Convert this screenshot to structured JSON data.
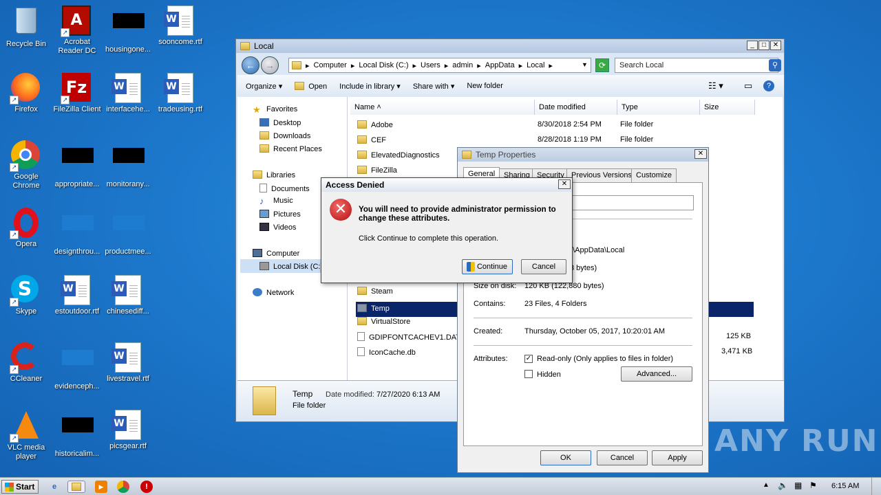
{
  "desktop": {
    "icons": [
      {
        "label": "Recycle Bin"
      },
      {
        "label": "Acrobat Reader DC"
      },
      {
        "label": "housingone..."
      },
      {
        "label": "sooncome.rtf"
      },
      {
        "label": "Firefox"
      },
      {
        "label": "FileZilla Client"
      },
      {
        "label": "interfacehe..."
      },
      {
        "label": "tradeusing.rtf"
      },
      {
        "label": "Google Chrome"
      },
      {
        "label": "appropriate..."
      },
      {
        "label": "monitorany..."
      },
      {
        "label": "Opera"
      },
      {
        "label": "designthrou..."
      },
      {
        "label": "productmee..."
      },
      {
        "label": "Skype"
      },
      {
        "label": "estoutdoor.rtf"
      },
      {
        "label": "chinesediff..."
      },
      {
        "label": "CCleaner"
      },
      {
        "label": "evidenceph..."
      },
      {
        "label": "livestravel.rtf"
      },
      {
        "label": "VLC media player"
      },
      {
        "label": "historicalim..."
      },
      {
        "label": "picsgear.rtf"
      }
    ]
  },
  "explorer": {
    "title": "Local",
    "breadcrumb": [
      "Computer",
      "Local Disk (C:)",
      "Users",
      "admin",
      "AppData",
      "Local"
    ],
    "search_placeholder": "Search Local",
    "toolbar": {
      "organize": "Organize",
      "open": "Open",
      "include": "Include in library",
      "share": "Share with",
      "new_folder": "New folder"
    },
    "nav": {
      "favorites": "Favorites",
      "desktop": "Desktop",
      "downloads": "Downloads",
      "recent": "Recent Places",
      "libraries": "Libraries",
      "documents": "Documents",
      "music": "Music",
      "pictures": "Pictures",
      "videos": "Videos",
      "computer": "Computer",
      "local_disk": "Local Disk (C:)",
      "network": "Network"
    },
    "columns": {
      "name": "Name",
      "date": "Date modified",
      "type": "Type",
      "size": "Size"
    },
    "files": [
      {
        "name": "Adobe",
        "date": "8/30/2018 2:54 PM",
        "type": "File folder",
        "size": ""
      },
      {
        "name": "CEF",
        "date": "8/28/2018 1:19 PM",
        "type": "File folder",
        "size": ""
      },
      {
        "name": "ElevatedDiagnostics",
        "date": "",
        "type": "",
        "size": ""
      },
      {
        "name": "FileZilla",
        "date": "",
        "type": "",
        "size": ""
      },
      {
        "name": "Steam",
        "date": "",
        "type": "",
        "size": ""
      },
      {
        "name": "Temp",
        "date": "",
        "type": "",
        "size": ""
      },
      {
        "name": "VirtualStore",
        "date": "",
        "type": "",
        "size": ""
      },
      {
        "name": "GDIPFONTCACHEV1.DAT",
        "date": "",
        "type": "",
        "size": "125 KB"
      },
      {
        "name": "IconCache.db",
        "date": "",
        "type": "",
        "size": "3,471 KB"
      }
    ],
    "details": {
      "name": "Temp",
      "date_label": "Date modified:",
      "date_value": "7/27/2020 6:13 AM",
      "type": "File folder"
    }
  },
  "properties": {
    "title": "Temp Properties",
    "tabs": [
      "General",
      "Sharing",
      "Security",
      "Previous Versions",
      "Customize"
    ],
    "location_partial": "n\\AppData\\Local",
    "size_partial": "3 bytes)",
    "size_on_disk_label": "Size on disk:",
    "size_on_disk_value": "120 KB (122,880 bytes)",
    "contains_label": "Contains:",
    "contains_value": "23 Files, 4 Folders",
    "created_label": "Created:",
    "created_value": "Thursday, October 05, 2017, 10:20:01 AM",
    "attributes_label": "Attributes:",
    "readonly": "Read-only (Only applies to files in folder)",
    "hidden": "Hidden",
    "advanced": "Advanced...",
    "ok": "OK",
    "cancel": "Cancel",
    "apply": "Apply"
  },
  "dialog": {
    "title": "Access Denied",
    "message": "You will need to provide administrator permission to change these attributes.",
    "hint": "Click Continue to complete this operation.",
    "continue": "Continue",
    "cancel": "Cancel"
  },
  "taskbar": {
    "start": "Start",
    "time": "6:15 AM"
  },
  "watermark": "ANY RUN"
}
